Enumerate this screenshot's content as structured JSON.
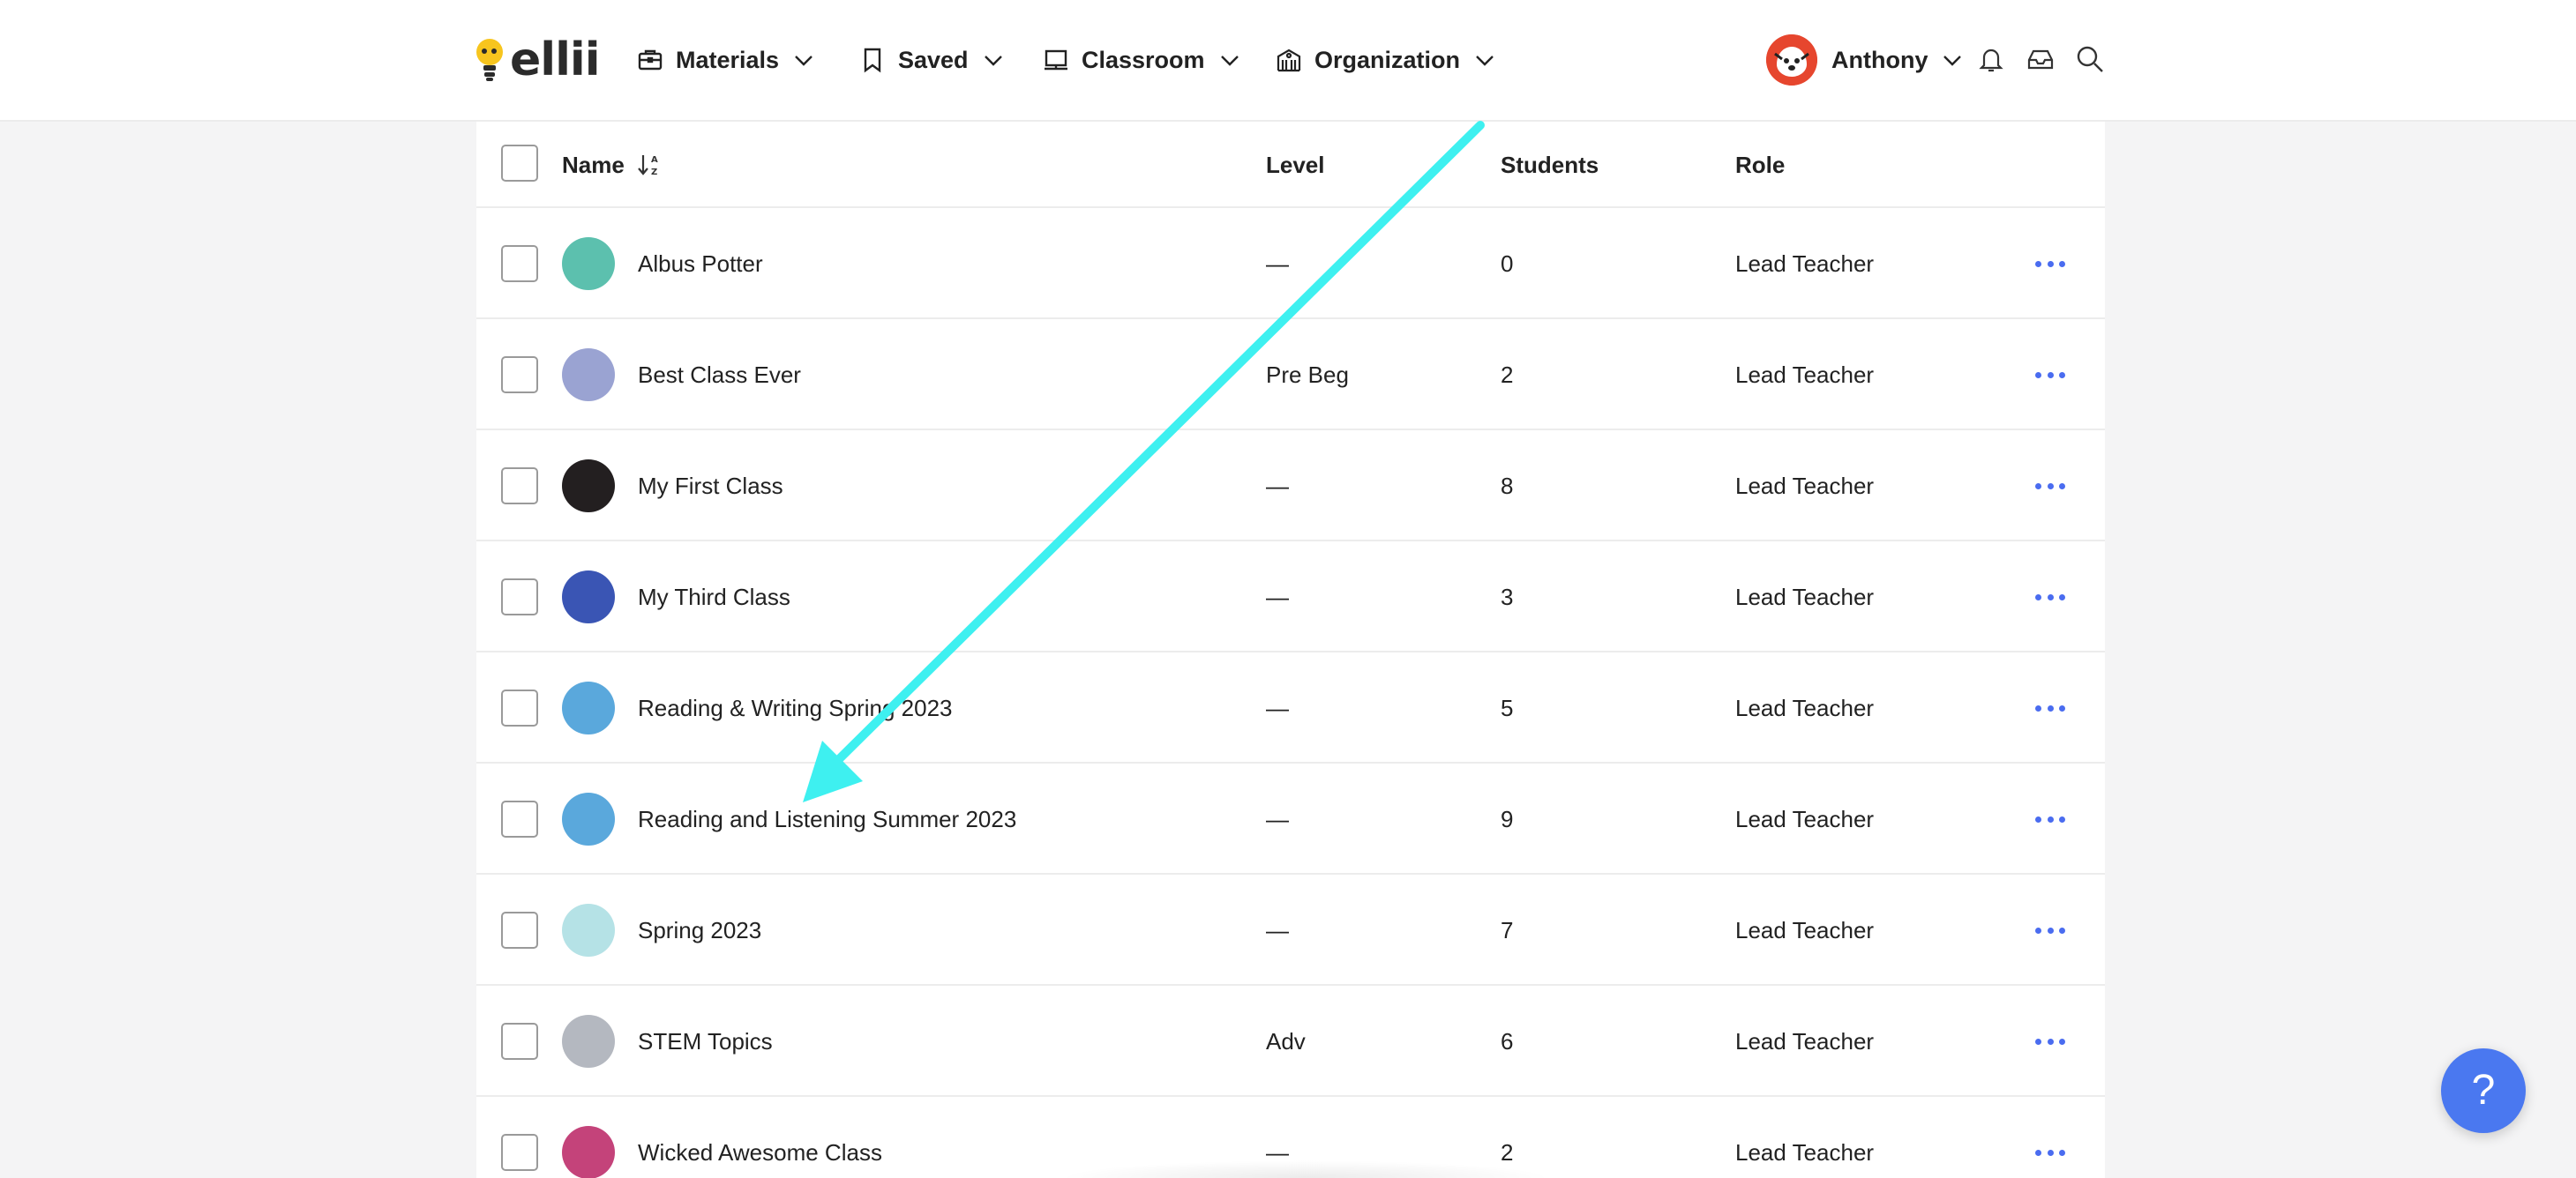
{
  "app": {
    "logo_text": "ellii"
  },
  "nav": {
    "items": [
      {
        "label": "Materials",
        "icon": "briefcase-icon"
      },
      {
        "label": "Saved",
        "icon": "bookmark-icon"
      },
      {
        "label": "Classroom",
        "icon": "board-icon"
      },
      {
        "label": "Organization",
        "icon": "building-icon"
      }
    ]
  },
  "user": {
    "name": "Anthony"
  },
  "table": {
    "headers": {
      "name": "Name",
      "level": "Level",
      "students": "Students",
      "role": "Role"
    },
    "rows": [
      {
        "name": "Albus Potter",
        "level": "—",
        "students": "0",
        "role": "Lead Teacher",
        "color": "#5cc0ae"
      },
      {
        "name": "Best Class Ever",
        "level": "Pre Beg",
        "students": "2",
        "role": "Lead Teacher",
        "color": "#9aa3d2"
      },
      {
        "name": "My First Class",
        "level": "—",
        "students": "8",
        "role": "Lead Teacher",
        "color": "#231f20"
      },
      {
        "name": "My Third Class",
        "level": "—",
        "students": "3",
        "role": "Lead Teacher",
        "color": "#3a55b4"
      },
      {
        "name": "Reading & Writing Spring 2023",
        "level": "—",
        "students": "5",
        "role": "Lead Teacher",
        "color": "#5aa8dc"
      },
      {
        "name": "Reading and Listening Summer 2023",
        "level": "—",
        "students": "9",
        "role": "Lead Teacher",
        "color": "#5aa8dc"
      },
      {
        "name": "Spring 2023",
        "level": "—",
        "students": "7",
        "role": "Lead Teacher",
        "color": "#b5e2e6"
      },
      {
        "name": "STEM Topics",
        "level": "Adv",
        "students": "6",
        "role": "Lead Teacher",
        "color": "#b4b8c0"
      },
      {
        "name": "Wicked Awesome Class",
        "level": "—",
        "students": "2",
        "role": "Lead Teacher",
        "color": "#c4437a"
      }
    ]
  },
  "help": {
    "label": "?"
  },
  "colors": {
    "accent": "#4a78f0",
    "annotation_arrow": "#3ef0f0",
    "more_dots": "#4a6cf0"
  }
}
